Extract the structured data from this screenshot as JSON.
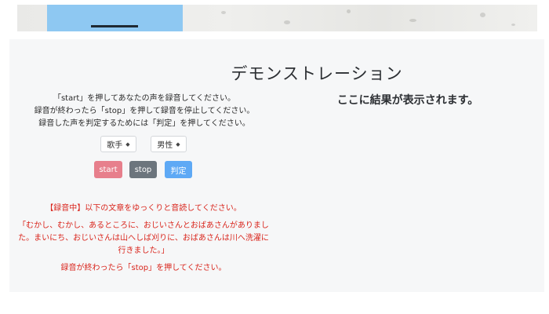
{
  "banner": {
    "accent_color": "#8ec8f2",
    "image": "textured-gray-banner"
  },
  "page_title": "デモンストレーション",
  "instructions": [
    "「start」を押してあなたの声を録音してください。",
    "録音が終わったら「stop」を押して録音を停止してください。",
    "録音した声を判定するためには「判定」を押してください。"
  ],
  "result": {
    "placeholder": "ここに結果が表示されます。"
  },
  "selects": {
    "singer": {
      "value": "歌手",
      "caret": "◆"
    },
    "gender": {
      "value": "男性",
      "caret": "◆"
    }
  },
  "buttons": {
    "start": "start",
    "stop": "stop",
    "judge": "判定"
  },
  "colors": {
    "start_button": "#e77f8c",
    "stop_button": "#6c757d",
    "judge_button": "#5ea9f5",
    "status_text": "#d9251c",
    "panel_background": "#f6f7f8"
  },
  "recording": {
    "status": "【録音中】以下の文章をゆっくりと音読してください。",
    "passage": [
      "「むかし、むかし、あるところに、おじいさんとおばあさんがありまし",
      "た。まいにち、おじいさんは山へしば刈りに、おばあさんは川へ洗濯に",
      "行きました。」"
    ],
    "end_instruction": "録音が終わったら「stop」を押してください。"
  }
}
